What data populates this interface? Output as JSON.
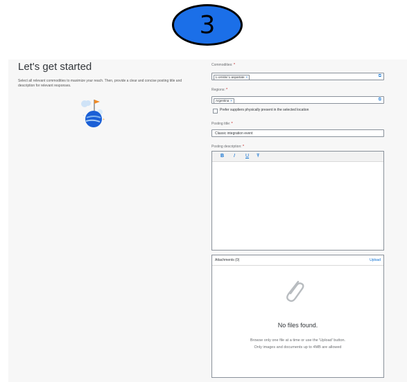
{
  "step": {
    "number": "3"
  },
  "intro": {
    "title": "Let's get started",
    "description": "Select all relevant commodities to maximize your reach. Then, provide a clear and concise posting title and description for relevant responses."
  },
  "form": {
    "commodities": {
      "label": "Commodities:",
      "required_mark": "*",
      "tokens": [
        "L-ornitin/ L-aspartate"
      ]
    },
    "regions": {
      "label": "Regions:",
      "required_mark": "*",
      "tokens": [
        "Argentina"
      ]
    },
    "prefer_suppliers": {
      "label": "Prefer suppliers physically present in the selected location",
      "checked": false
    },
    "posting_title": {
      "label": "Posting title:",
      "required_mark": "*",
      "value": "Classic integration event"
    },
    "posting_description": {
      "label": "Posting description:",
      "required_mark": "*",
      "value": ""
    },
    "editor_toolbar": {
      "bold": "B",
      "italic": "I",
      "underline": "U",
      "strike": "Ŧ"
    },
    "attachments": {
      "title": "Attachments (0)",
      "upload_label": "Upload",
      "empty_title": "No files found.",
      "hint_line1": "Browse only one file at a time or use the 'Upload' button.",
      "hint_line2": "Only images and documents up to 4MB are allowed"
    }
  },
  "colors": {
    "accent": "#0a6ed1",
    "badge": "#1b6fe8",
    "required": "#bb0000"
  }
}
